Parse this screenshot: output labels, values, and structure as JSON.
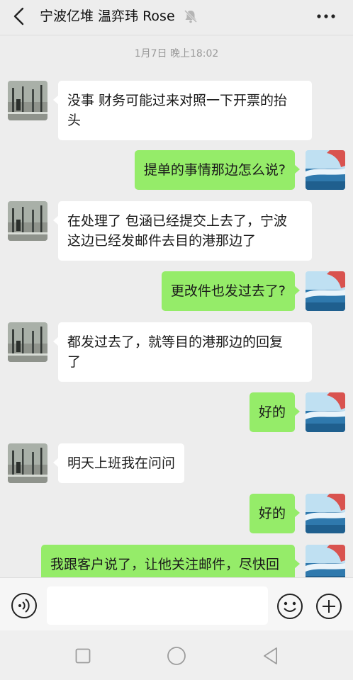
{
  "header": {
    "back_icon": "chevron-left-icon",
    "title": "宁波亿堆 温弈玮 Rose",
    "mute_icon": "muted-bell-icon",
    "more_icon": "more-dots-icon"
  },
  "chat": {
    "timestamp": "1月7日 晚上18:02",
    "messages": [
      {
        "side": "in",
        "text": "没事 财务可能过来对照一下开票的抬\n头"
      },
      {
        "side": "out",
        "text": "提单的事情那边怎么说?"
      },
      {
        "side": "in",
        "text": "在处理了 包涵已经提交上去了，宁波\n这边已经发邮件去目的港那边了"
      },
      {
        "side": "out",
        "text": "更改件也发过去了?"
      },
      {
        "side": "in",
        "text": "都发过去了，就等目的港那边的回复\n了"
      },
      {
        "side": "out",
        "text": "好的"
      },
      {
        "side": "in",
        "text": "明天上班我在问问"
      },
      {
        "side": "out",
        "text": "好的"
      },
      {
        "side": "out",
        "text": "我跟客户说了，让他关注邮件，尽快回"
      }
    ]
  },
  "input_bar": {
    "voice_icon": "voice-icon",
    "emoji_icon": "emoji-icon",
    "plus_icon": "plus-icon",
    "text_value": ""
  },
  "nav": {
    "recents_icon": "square-icon",
    "home_icon": "circle-icon",
    "back_icon": "triangle-back-icon"
  },
  "colors": {
    "background": "#ededed",
    "bubble_out": "#95ec69",
    "bubble_in": "#ffffff"
  }
}
